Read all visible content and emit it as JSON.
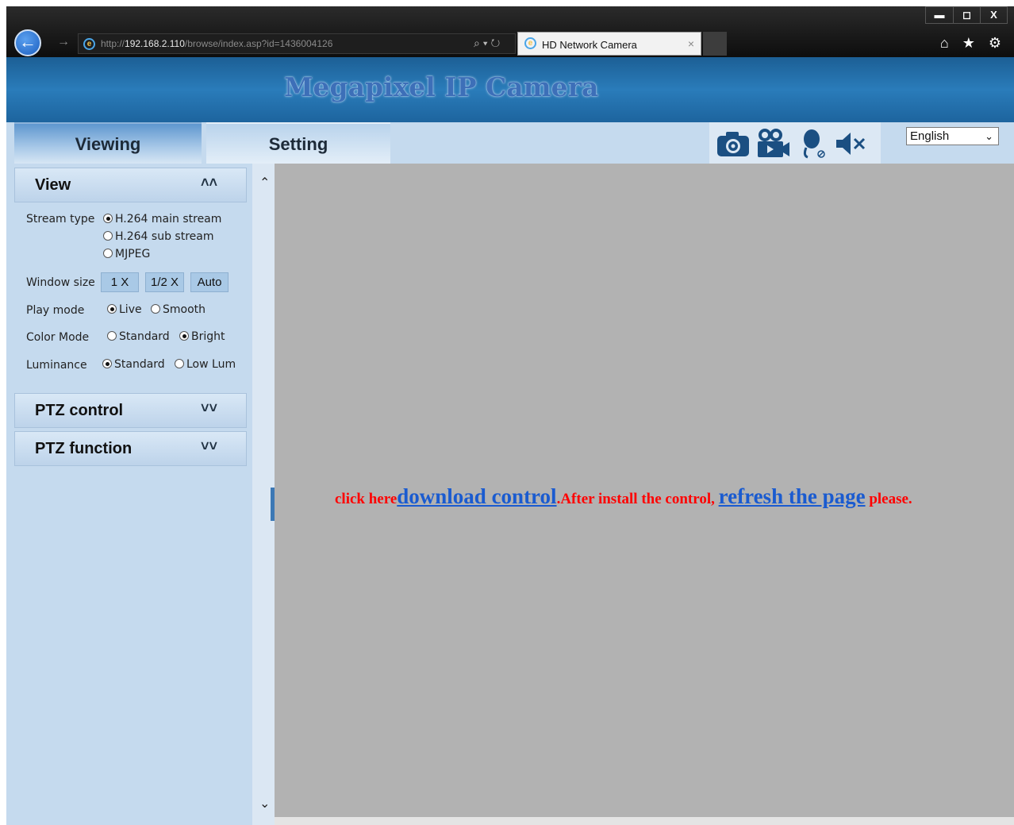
{
  "browser": {
    "url_prefix": "http://",
    "url_host": "192.168.2.110",
    "url_path": "/browse/index.asp?id=1436004126",
    "address_tools": "⌕ ▾ ↻",
    "tab_title": "HD Network Camera",
    "tab_close": "×",
    "window_buttons": [
      "▬",
      "◻",
      "X"
    ],
    "chrome_icons": "⌂ ★ ⚙"
  },
  "banner": {
    "title": "Megapixel IP Camera"
  },
  "nav": {
    "viewing": "Viewing",
    "setting": "Setting",
    "language": "English"
  },
  "toolbar": {
    "icons": [
      "camera-icon",
      "record-icon",
      "microphone-icon",
      "mute-icon"
    ]
  },
  "view": {
    "title": "View",
    "stream_type_label": "Stream type",
    "stream_options": [
      "H.264 main stream",
      "H.264 sub stream",
      "MJPEG"
    ],
    "stream_selected": "H.264 main stream",
    "window_size_label": "Window size",
    "window_sizes": [
      "1 X",
      "1/2 X",
      "Auto"
    ],
    "play_mode_label": "Play mode",
    "play_options": [
      "Live",
      "Smooth"
    ],
    "play_selected": "Live",
    "color_mode_label": "Color Mode",
    "color_options": [
      "Standard",
      "Bright"
    ],
    "color_selected": "Bright",
    "luminance_label": "Luminance",
    "luminance_options": [
      "Standard",
      "Low Lum"
    ],
    "luminance_selected": "Standard"
  },
  "ptz_control": {
    "title": "PTZ control"
  },
  "ptz_function": {
    "title": "PTZ function"
  },
  "message": {
    "prefix": "click here",
    "download_link": "download control",
    "middle": ".After install the control,",
    "refresh_link": "refresh the page",
    "suffix": "please."
  },
  "colors": {
    "banner": "#2a7cba",
    "panel": "#c5daee",
    "video_bg": "#b2b2b2",
    "message_red": "#ff0000",
    "link_blue": "#1a5bd0"
  }
}
